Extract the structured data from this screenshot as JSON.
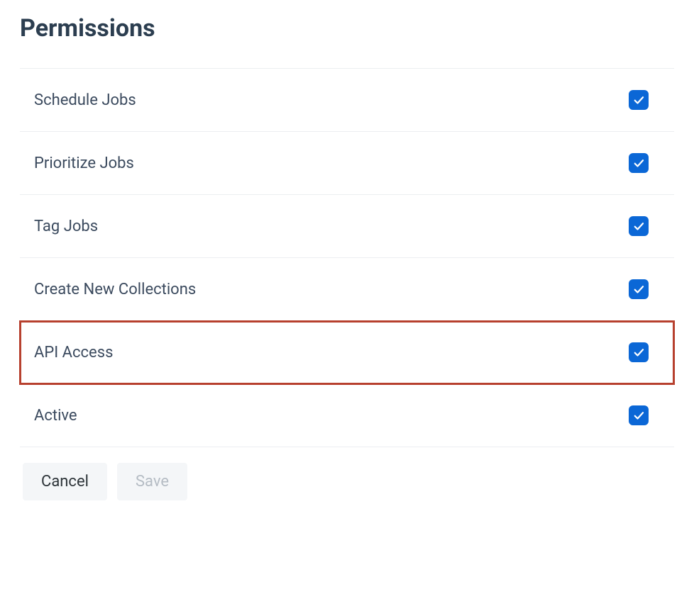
{
  "title": "Permissions",
  "permissions": [
    {
      "label": "Schedule Jobs",
      "checked": true,
      "highlighted": false
    },
    {
      "label": "Prioritize Jobs",
      "checked": true,
      "highlighted": false
    },
    {
      "label": "Tag Jobs",
      "checked": true,
      "highlighted": false
    },
    {
      "label": "Create New Collections",
      "checked": true,
      "highlighted": false
    },
    {
      "label": "API Access",
      "checked": true,
      "highlighted": true
    },
    {
      "label": "Active",
      "checked": true,
      "highlighted": false
    }
  ],
  "buttons": {
    "cancel": "Cancel",
    "save": "Save"
  },
  "colors": {
    "checkbox_bg": "#0b67d6",
    "highlight_border": "#b7402e"
  }
}
